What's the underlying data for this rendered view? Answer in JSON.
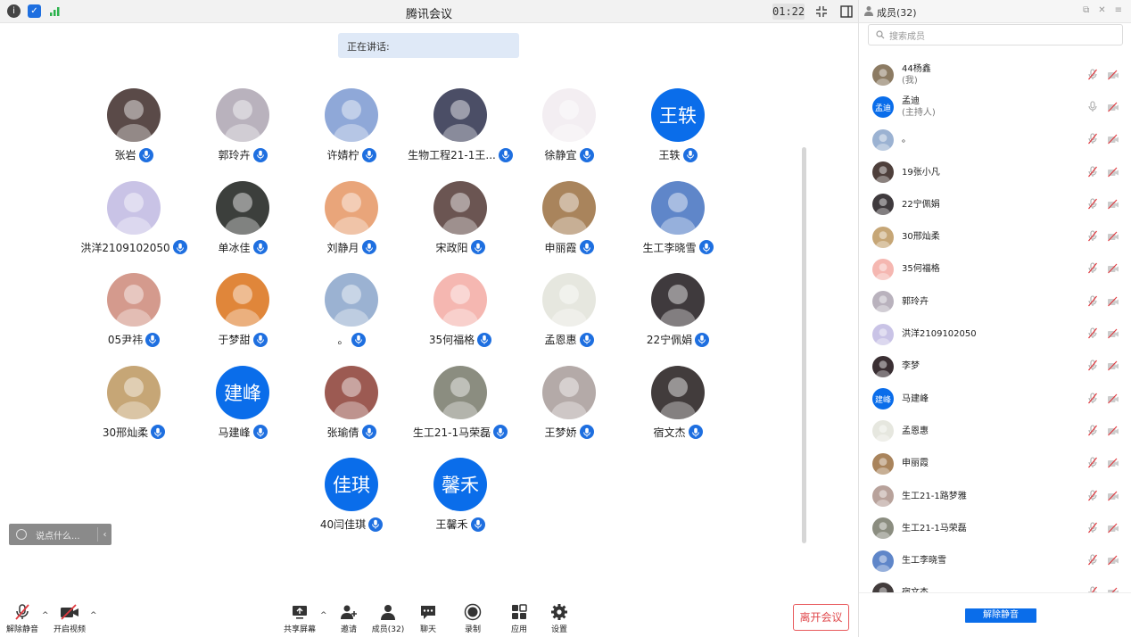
{
  "title": "腾讯会议",
  "timer": "01:22",
  "speaking_label": "正在讲话:",
  "chat_placeholder": "说点什么...",
  "participants": [
    {
      "name": "张岩",
      "avatar": "photo",
      "color": "#5a4a48"
    },
    {
      "name": "郭玲卉",
      "avatar": "photo",
      "color": "#b9b2bd"
    },
    {
      "name": "许婧柠",
      "avatar": "photo",
      "color": "#8fa8d8"
    },
    {
      "name": "生物工程21-1王...",
      "avatar": "photo",
      "color": "#4b4e66"
    },
    {
      "name": "徐静宜",
      "avatar": "photo",
      "color": "#f3eef2"
    },
    {
      "name": "王轶",
      "avatar": "text",
      "text": "王轶"
    },
    {
      "name": "洪洋2109102050",
      "avatar": "photo",
      "color": "#c9c3e6"
    },
    {
      "name": "单冰佳",
      "avatar": "photo",
      "color": "#3c3f3c"
    },
    {
      "name": "刘静月",
      "avatar": "photo",
      "color": "#e9a57a"
    },
    {
      "name": "宋政阳",
      "avatar": "photo",
      "color": "#6b5552"
    },
    {
      "name": "申丽霞",
      "avatar": "photo",
      "color": "#a9845c"
    },
    {
      "name": "生工李晓雪",
      "avatar": "photo",
      "color": "#5f86c9"
    },
    {
      "name": "05尹祎",
      "avatar": "photo",
      "color": "#d49a8d"
    },
    {
      "name": "于梦甜",
      "avatar": "photo",
      "color": "#e0863a"
    },
    {
      "name": "。",
      "avatar": "photo",
      "color": "#9bb2d2"
    },
    {
      "name": "35何福格",
      "avatar": "photo",
      "color": "#f5b7b1"
    },
    {
      "name": "孟恩惠",
      "avatar": "photo",
      "color": "#e6e7df"
    },
    {
      "name": "22宁佩娟",
      "avatar": "photo",
      "color": "#3f3a3d"
    },
    {
      "name": "30邢灿柔",
      "avatar": "photo",
      "color": "#c6a676"
    },
    {
      "name": "马建峰",
      "avatar": "text",
      "text": "建峰"
    },
    {
      "name": "张瑜倩",
      "avatar": "photo",
      "color": "#9c5a52"
    },
    {
      "name": "生工21-1马荣磊",
      "avatar": "photo",
      "color": "#8b8d80"
    },
    {
      "name": "王梦娇",
      "avatar": "photo",
      "color": "#b4aaa8"
    },
    {
      "name": "宿文杰",
      "avatar": "photo",
      "color": "#423c3c"
    },
    {
      "name": "40闫佳琪",
      "avatar": "text",
      "text": "佳琪"
    },
    {
      "name": "王馨禾",
      "avatar": "text",
      "text": "馨禾"
    }
  ],
  "toolbar": {
    "unmute": "解除静音",
    "start_video": "开启视频",
    "share": "共享屏幕",
    "invite": "邀请",
    "members": "成员(32)",
    "chat": "聊天",
    "record": "录制",
    "apps": "应用",
    "settings": "设置",
    "leave": "离开会议"
  },
  "panel": {
    "title": "成员(32)",
    "search_placeholder": "搜索成员",
    "unmute_all": "解除静音",
    "members": [
      {
        "name": "44杨鑫",
        "sub": "(我)",
        "avatar": "photo",
        "color": "#8c7b63",
        "mic": "muted"
      },
      {
        "name": "孟迪",
        "sub": "(主持人)",
        "avatar": "text",
        "text": "孟迪",
        "mic": "on"
      },
      {
        "name": "。",
        "avatar": "photo",
        "color": "#9bb2d2",
        "mic": "muted"
      },
      {
        "name": "19张小凡",
        "avatar": "photo",
        "color": "#4e3f3b",
        "mic": "muted"
      },
      {
        "name": "22宁佩娟",
        "avatar": "photo",
        "color": "#3f3a3d",
        "mic": "muted"
      },
      {
        "name": "30邢灿柔",
        "avatar": "photo",
        "color": "#c6a676",
        "mic": "muted"
      },
      {
        "name": "35何福格",
        "avatar": "photo",
        "color": "#f5b7b1",
        "mic": "muted"
      },
      {
        "name": "郭玲卉",
        "avatar": "photo",
        "color": "#b9b2bd",
        "mic": "muted"
      },
      {
        "name": "洪洋2109102050",
        "avatar": "photo",
        "color": "#c9c3e6",
        "mic": "muted"
      },
      {
        "name": "李梦",
        "avatar": "photo",
        "color": "#3a2f33",
        "mic": "muted"
      },
      {
        "name": "马建峰",
        "avatar": "text",
        "text": "建峰",
        "mic": "muted"
      },
      {
        "name": "孟恩惠",
        "avatar": "photo",
        "color": "#e6e7df",
        "mic": "muted"
      },
      {
        "name": "申丽霞",
        "avatar": "photo",
        "color": "#a9845c",
        "mic": "muted"
      },
      {
        "name": "生工21-1路梦雅",
        "avatar": "photo",
        "color": "#b8a29b",
        "mic": "muted"
      },
      {
        "name": "生工21-1马荣磊",
        "avatar": "photo",
        "color": "#8b8d80",
        "mic": "muted"
      },
      {
        "name": "生工李晓雪",
        "avatar": "photo",
        "color": "#5f86c9",
        "mic": "muted"
      },
      {
        "name": "宿文杰",
        "avatar": "photo",
        "color": "#423c3c",
        "mic": "muted"
      }
    ]
  }
}
